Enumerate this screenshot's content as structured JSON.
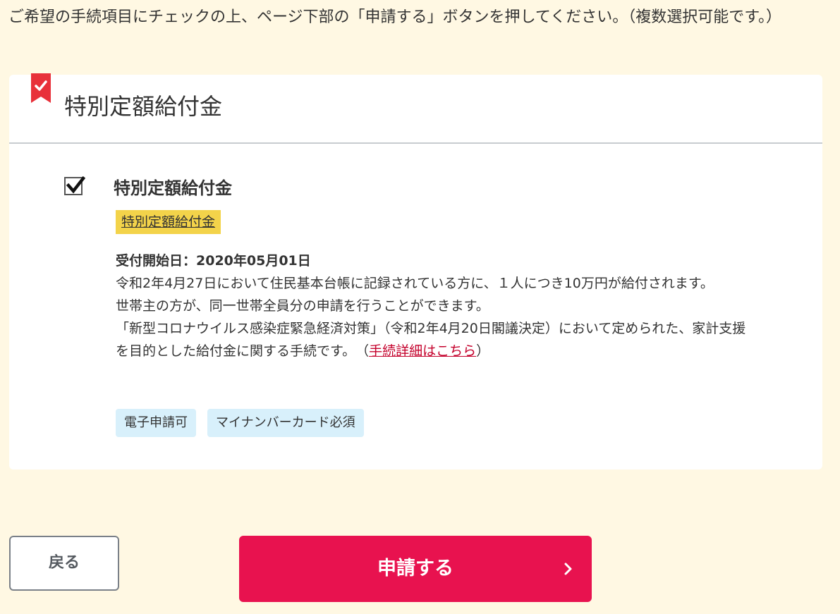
{
  "instruction": "ご希望の手続項目にチェックの上、ページ下部の「申請する」ボタンを押してください。（複数選択可能です。）",
  "card": {
    "title": "特別定額給付金",
    "item": {
      "checked": true,
      "title": "特別定額給付金",
      "link_tag": "特別定額給付金",
      "start_date": "受付開始日：2020年05月01日",
      "desc_line1": "令和2年4月27日において住民基本台帳に記録されている方に、１人につき10万円が給付されます。",
      "desc_line2": "世帯主の方が、同一世帯全員分の申請を行うことができます。",
      "desc_line3": "「新型コロナウイルス感染症緊急経済対策」（令和2年4月20日閣議決定）において定められた、家計支援を目的とした給付金に関する手続です。　（",
      "detail_link": "手続詳細はこちら",
      "desc_close": "）",
      "tags": [
        "電子申請可",
        "マイナンバーカード必須"
      ]
    }
  },
  "buttons": {
    "back": "戻る",
    "submit": "申請する"
  },
  "colors": {
    "background": "#fff8e3",
    "accent": "#e8124f",
    "tag_bg": "#d8f0fb",
    "link_tag_bg": "#f3d34a",
    "link": "#c4002b"
  }
}
